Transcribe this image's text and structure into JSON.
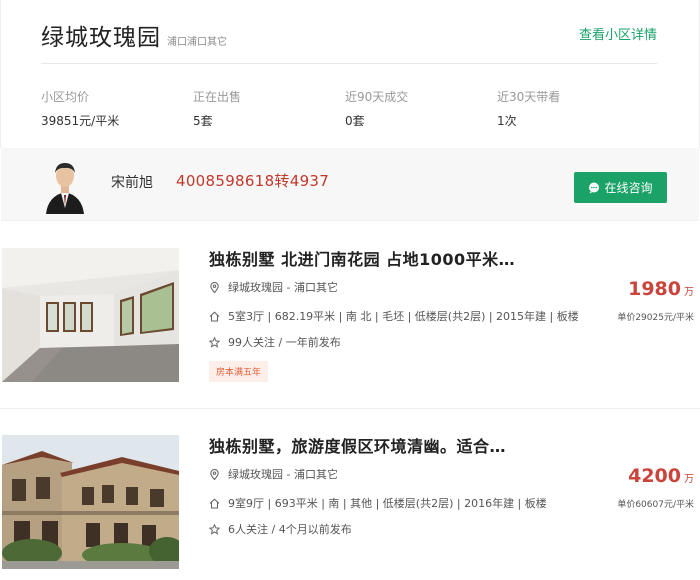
{
  "community": {
    "name": "绿城玫瑰园",
    "location": "浦口浦口其它",
    "detail_link": "查看小区详情"
  },
  "stats": [
    {
      "label": "小区均价",
      "value": "39851元/平米"
    },
    {
      "label": "正在出售",
      "value": "5套"
    },
    {
      "label": "近90天成交",
      "value": "0套"
    },
    {
      "label": "近30天带看",
      "value": "1次"
    }
  ],
  "agent": {
    "name": "宋前旭",
    "phone": "4008598618转4937",
    "consult_label": "在线咨询"
  },
  "listings": [
    {
      "title": "独栋别墅 北进门南花园 占地1000平米…",
      "location": "绿城玫瑰园 - 浦口其它",
      "specs": "5室3厅 | 682.19平米 | 南 北 | 毛坯 | 低楼层(共2层) | 2015年建 | 板楼",
      "follow": "99人关注 / 一年前发布",
      "tag": "房本满五年",
      "price": "1980",
      "price_unit": "万",
      "unit_price": "单价29025元/平米"
    },
    {
      "title": "独栋别墅，旅游度假区环境清幽。适合…",
      "location": "绿城玫瑰园 - 浦口其它",
      "specs": "9室9厅 | 693平米 | 南 | 其他 | 低楼层(共2层) | 2016年建 | 板楼",
      "follow": "6人关注 / 4个月以前发布",
      "price": "4200",
      "price_unit": "万",
      "unit_price": "单价60607元/平米"
    }
  ],
  "colors": {
    "accent_green": "#1aa268",
    "price_red": "#c9443b",
    "phone_red": "#c0392b",
    "tag_orange": "#e45f3c"
  }
}
